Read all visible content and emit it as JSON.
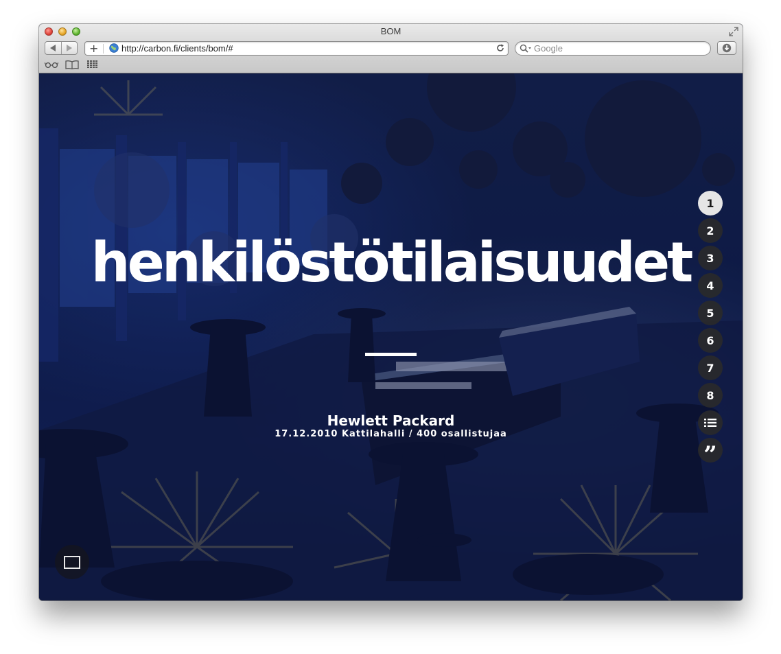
{
  "window": {
    "title": "BOM",
    "address_url": "http://carbon.fi/clients/bom/#",
    "search_placeholder": "Google",
    "add_label": "+"
  },
  "toolbar": {
    "icons": [
      "back-icon",
      "forward-icon",
      "globe-icon",
      "reload-icon",
      "magnifier-icon",
      "download-icon",
      "reading-list-icon",
      "bookmarks-book-icon",
      "top-sites-grid-icon",
      "fullscreen-arrows-icon"
    ]
  },
  "hero": {
    "title": "henkilöstötilaisuudet",
    "client": "Hewlett Packard",
    "event_info": "17.12.2010 Kattilahalli / 400 osallistujaa"
  },
  "slide_nav": {
    "items": [
      "1",
      "2",
      "3",
      "4",
      "5",
      "6",
      "7",
      "8"
    ],
    "active_index": 0,
    "list_icon": "list-icon",
    "quote_glyph": "”"
  },
  "colors": {
    "background_blue": "#14224e",
    "nav_dot": "#2a2a2a",
    "nav_dot_active": "#e6e6e6",
    "text": "#ffffff"
  }
}
